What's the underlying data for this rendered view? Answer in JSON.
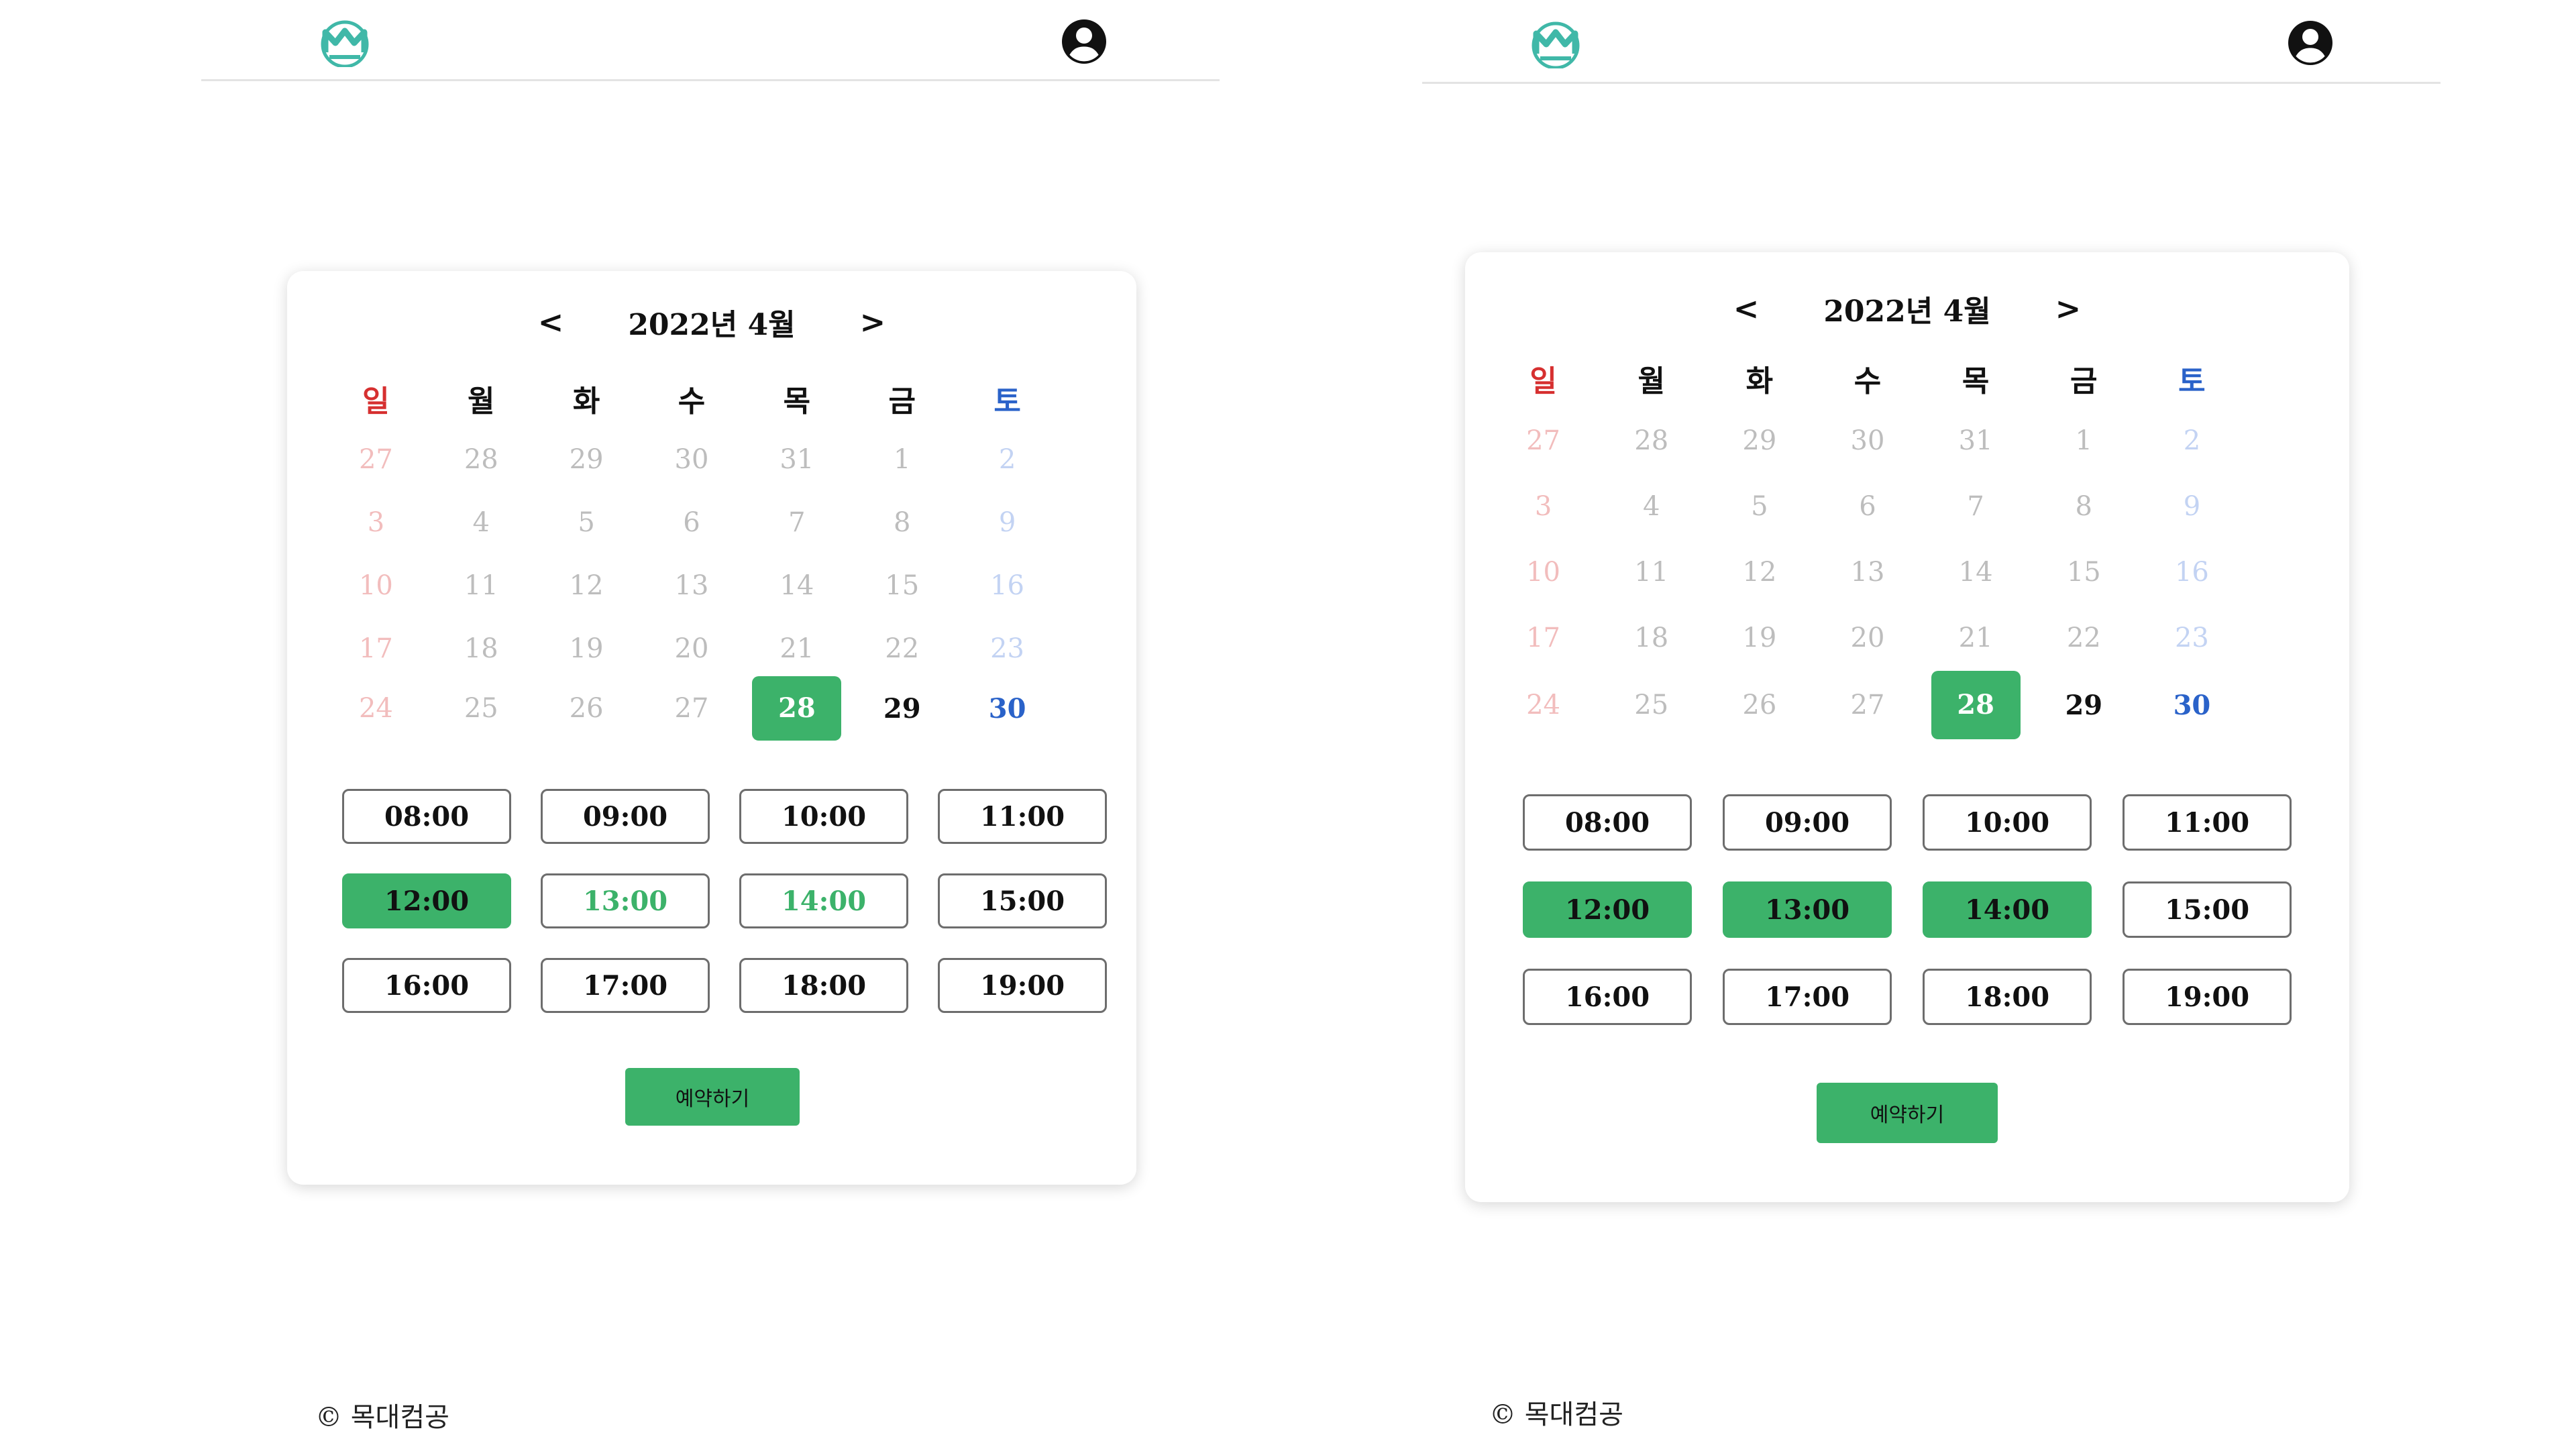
{
  "panels": [
    {
      "calendar_title": "2022년 4월",
      "prev_label": "<",
      "next_label": ">",
      "weekdays": [
        "일",
        "월",
        "화",
        "수",
        "목",
        "금",
        "토"
      ],
      "weeks": [
        [
          "27",
          "28",
          "29",
          "30",
          "31",
          "1",
          "2"
        ],
        [
          "3",
          "4",
          "5",
          "6",
          "7",
          "8",
          "9"
        ],
        [
          "10",
          "11",
          "12",
          "13",
          "14",
          "15",
          "16"
        ],
        [
          "17",
          "18",
          "19",
          "20",
          "21",
          "22",
          "23"
        ],
        [
          "24",
          "25",
          "26",
          "27",
          "28",
          "29",
          "30"
        ]
      ],
      "selected_date": "28",
      "time_slots": [
        "08:00",
        "09:00",
        "10:00",
        "11:00",
        "12:00",
        "13:00",
        "14:00",
        "15:00",
        "16:00",
        "17:00",
        "18:00",
        "19:00"
      ],
      "selected_times": [
        "12:00"
      ],
      "available_times": [
        "13:00",
        "14:00"
      ],
      "reserve_button": "예약하기",
      "footer": "© 목대컴공"
    },
    {
      "calendar_title": "2022년 4월",
      "prev_label": "<",
      "next_label": ">",
      "weekdays": [
        "일",
        "월",
        "화",
        "수",
        "목",
        "금",
        "토"
      ],
      "weeks": [
        [
          "27",
          "28",
          "29",
          "30",
          "31",
          "1",
          "2"
        ],
        [
          "3",
          "4",
          "5",
          "6",
          "7",
          "8",
          "9"
        ],
        [
          "10",
          "11",
          "12",
          "13",
          "14",
          "15",
          "16"
        ],
        [
          "17",
          "18",
          "19",
          "20",
          "21",
          "22",
          "23"
        ],
        [
          "24",
          "25",
          "26",
          "27",
          "28",
          "29",
          "30"
        ]
      ],
      "selected_date": "28",
      "time_slots": [
        "08:00",
        "09:00",
        "10:00",
        "11:00",
        "12:00",
        "13:00",
        "14:00",
        "15:00",
        "16:00",
        "17:00",
        "18:00",
        "19:00"
      ],
      "selected_times": [
        "12:00",
        "13:00",
        "14:00"
      ],
      "available_times": [],
      "reserve_button": "예약하기",
      "footer": "© 목대컴공"
    }
  ],
  "colors": {
    "accent": "#3cb26a",
    "sunday": "#d63030",
    "saturday": "#2a62c9",
    "muted": "#bdbdbd"
  }
}
